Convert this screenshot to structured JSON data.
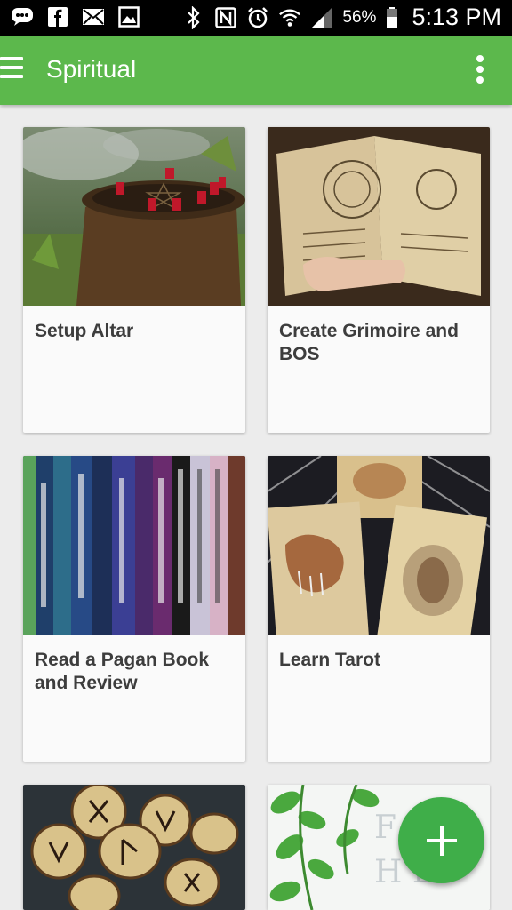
{
  "status_bar": {
    "battery_percent": "56%",
    "time": "5:13 PM",
    "icons": [
      "messenger-icon",
      "facebook-icon",
      "mail-icon",
      "gallery-icon",
      "bluetooth-icon",
      "nfc-icon",
      "alarm-icon",
      "wifi-icon",
      "signal-icon",
      "battery-icon"
    ]
  },
  "app_bar": {
    "title": "Spiritual",
    "menu_icon": "hamburger-menu-icon",
    "overflow_icon": "more-vert-icon"
  },
  "cards": [
    {
      "title": "Setup Altar"
    },
    {
      "title": "Create Grimoire and BOS"
    },
    {
      "title": "Read a Pagan Book and Review"
    },
    {
      "title": "Learn Tarot"
    },
    {
      "title": ""
    },
    {
      "title": ""
    }
  ],
  "fab": {
    "icon": "plus-icon"
  },
  "colors": {
    "accent": "#5cb84c",
    "fab": "#3fae49"
  }
}
